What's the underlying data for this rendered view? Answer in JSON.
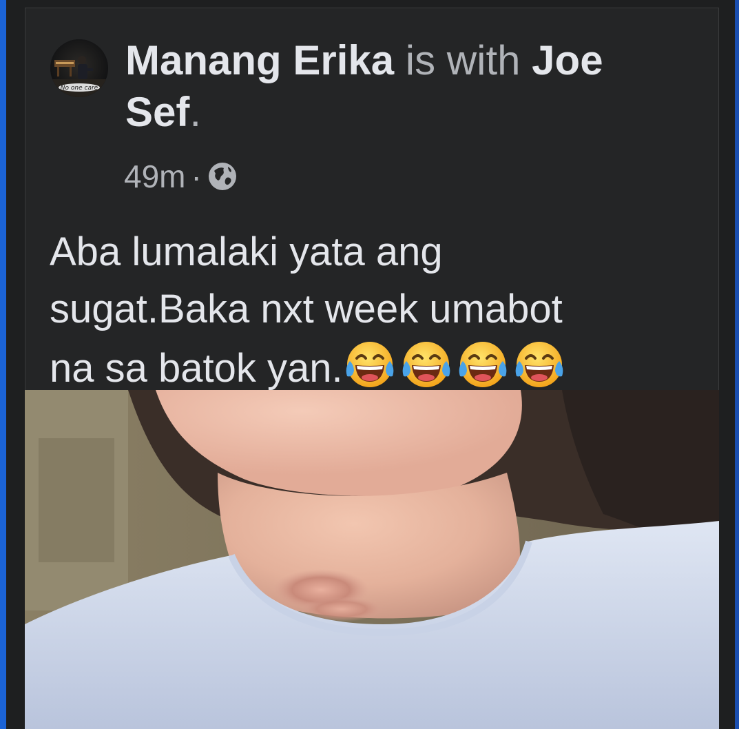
{
  "post": {
    "author": "Manang Erika",
    "with_text": "is with",
    "tagged": "Joe",
    "tagged_2": "Sef",
    "period": ".",
    "time": "49m",
    "separator": "·",
    "audience_icon": "globe-icon",
    "text_line_1": "Aba lumalaki yata ang",
    "text_line_2": "sugat.Baka nxt week umabot",
    "text_line_3": "na sa batok yan.",
    "emoji": [
      "face-with-tears-of-joy",
      "face-with-tears-of-joy",
      "face-with-tears-of-joy",
      "face-with-tears-of-joy"
    ],
    "avatar_caption": "No one care"
  },
  "colors": {
    "background": "#242526",
    "primary_text": "#e4e6eb",
    "secondary_text": "#b0b3b8",
    "accent": "#1b63d6"
  }
}
